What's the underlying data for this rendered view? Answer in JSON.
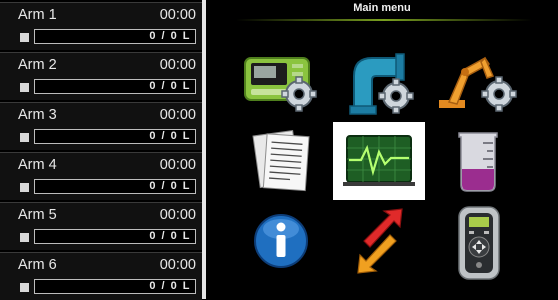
{
  "menu": {
    "title": "Main menu"
  },
  "arms": [
    {
      "name": "Arm 1",
      "time": "00:00",
      "volume": "0 / 0 L"
    },
    {
      "name": "Arm 2",
      "time": "00:00",
      "volume": "0 / 0 L"
    },
    {
      "name": "Arm 3",
      "time": "00:00",
      "volume": "0 / 0 L"
    },
    {
      "name": "Arm 4",
      "time": "00:00",
      "volume": "0 / 0 L"
    },
    {
      "name": "Arm 5",
      "time": "00:00",
      "volume": "0 / 0 L"
    },
    {
      "name": "Arm 6",
      "time": "00:00",
      "volume": "0 / 0 L"
    }
  ],
  "tiles": [
    {
      "icon": "controller-settings-icon"
    },
    {
      "icon": "pipe-settings-icon"
    },
    {
      "icon": "robot-arm-settings-icon"
    },
    {
      "icon": "documents-icon"
    },
    {
      "icon": "monitor-graph-icon",
      "selected": true
    },
    {
      "icon": "beaker-icon"
    },
    {
      "icon": "info-icon"
    },
    {
      "icon": "transfer-arrows-icon"
    },
    {
      "icon": "handheld-terminal-icon"
    }
  ],
  "colors": {
    "accent_line": "#7aa020",
    "selected_tile": "#ffffff"
  }
}
